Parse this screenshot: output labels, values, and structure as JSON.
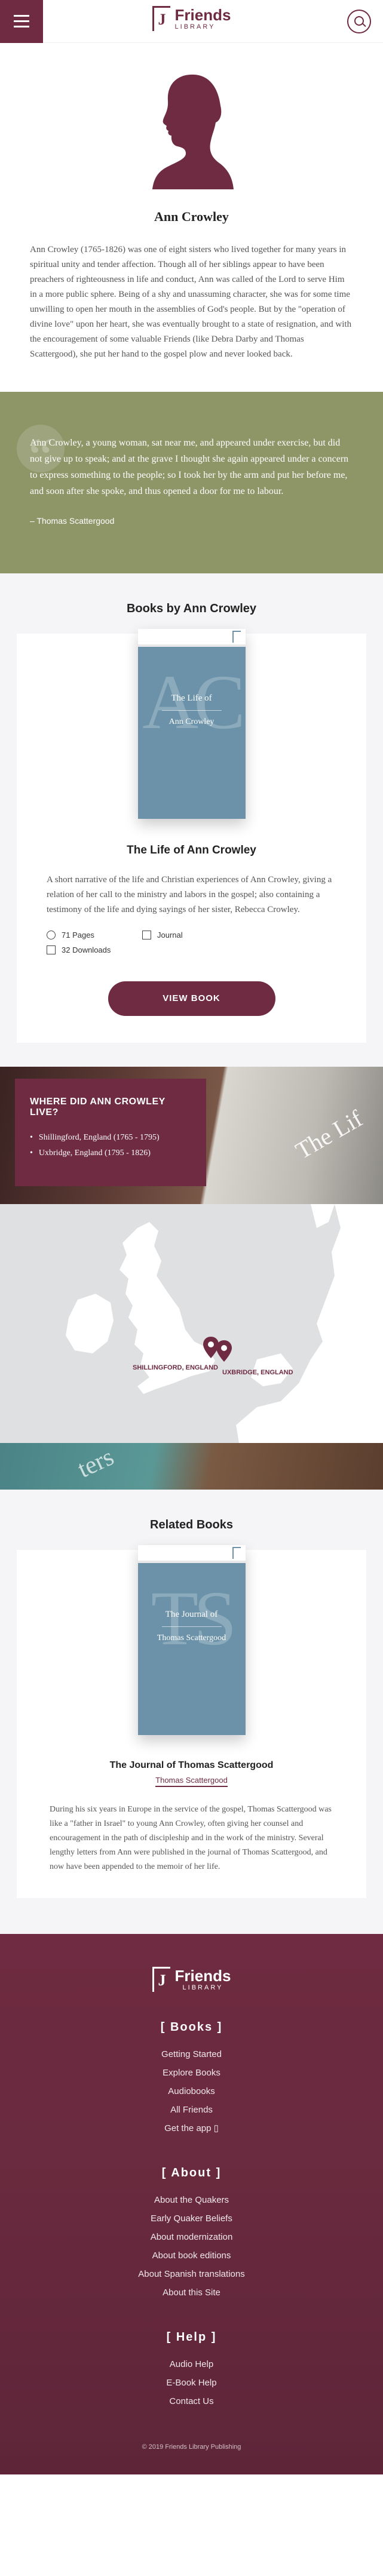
{
  "header": {
    "logo_text": "Friends",
    "logo_sub": "LIBRARY",
    "logo_mark": "J"
  },
  "author": {
    "name": "Ann Crowley",
    "bio": "Ann Crowley (1765-1826) was one of eight sisters who lived together for many years in spiritual unity and tender affection. Though all of her siblings appear to have been preachers of righteousness in life and conduct, Ann was called of the Lord to serve Him in a more public sphere. Being of a shy and unassuming character, she was for some time unwilling to open her mouth in the assemblies of God's people. But by the \"operation of divine love\" upon her heart, she was eventually brought to a state of resignation, and with the encouragement of some valuable Friends (like Debra Darby and Thomas Scattergood), she put her hand to the gospel plow and never looked back."
  },
  "quote": {
    "text": "Ann Crowley, a young woman, sat near me, and appeared under exercise, but did not give up to speak; and at the grave I thought she again appeared under a concern to express something to the people; so I took her by the arm and put her before me, and soon after she spoke, and thus opened a door for me to labour.",
    "cite": "– Thomas Scattergood"
  },
  "books": {
    "title": "Books by Ann Crowley",
    "items": [
      {
        "cover_initials": "AC",
        "cover_title": "The Life of",
        "cover_author": "Ann Crowley",
        "title": "The Life of Ann Crowley",
        "description": "A short narrative of the life and Christian experiences of Ann Crowley, giving a relation of her call to the ministry and labors in the gospel; also containing a testimony of the life and dying sayings of her sister, Rebecca Crowley.",
        "pages": "71 Pages",
        "type": "Journal",
        "downloads": "32 Downloads",
        "button": "VIEW BOOK"
      }
    ]
  },
  "where": {
    "title": "WHERE DID ANN CROWLEY LIVE?",
    "places": [
      "Shillingford, England (1765 - 1795)",
      "Uxbridge, England (1795 - 1826)"
    ],
    "map_labels": [
      "SHILLINGFORD, ENGLAND",
      "UXBRIDGE, ENGLAND"
    ]
  },
  "related": {
    "title": "Related Books",
    "items": [
      {
        "cover_initials": "TS",
        "cover_title": "The Journal of",
        "cover_author": "Thomas Scattergood",
        "title": "The Journal of Thomas Scattergood",
        "author": "Thomas Scattergood",
        "description": "During his six years in Europe in the service of the gospel, Thomas Scattergood was like a \"father in Israel\" to young Ann Crowley, often giving her counsel and encouragement in the path of discipleship and in the work of the ministry. Several lengthy letters from Ann were published in the journal of Thomas Scattergood, and now have been appended to the memoir of her life."
      }
    ]
  },
  "footer": {
    "groups": [
      {
        "title": "Books",
        "links": [
          "Getting Started",
          "Explore Books",
          "Audiobooks",
          "All Friends",
          "Get the app"
        ]
      },
      {
        "title": "About",
        "links": [
          "About the Quakers",
          "Early Quaker Beliefs",
          "About modernization",
          "About book editions",
          "About Spanish translations",
          "About this Site"
        ]
      },
      {
        "title": "Help",
        "links": [
          "Audio Help",
          "E-Book Help",
          "Contact Us"
        ]
      }
    ],
    "copyright": "© 2019 Friends Library Publishing"
  },
  "colors": {
    "brand": "#6e2b41",
    "quote_bg": "#8e9668",
    "cover_blue": "#6b92a8"
  }
}
